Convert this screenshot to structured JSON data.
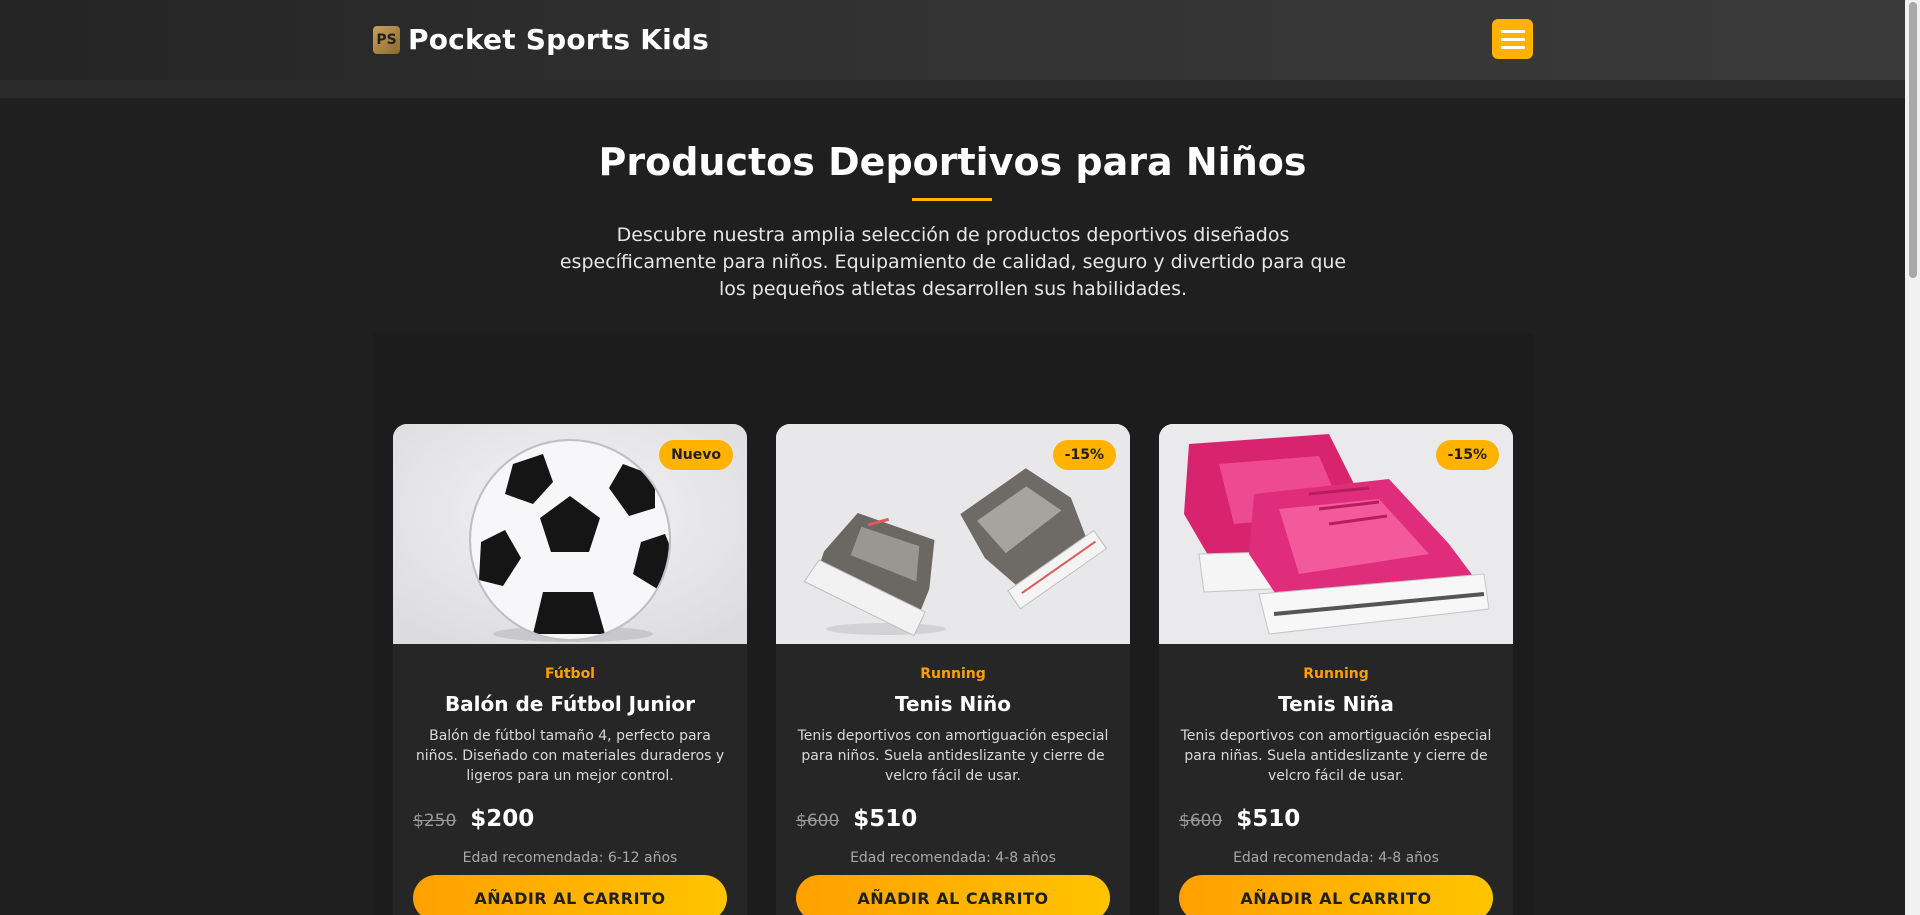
{
  "brand": {
    "logo_initials": "PS",
    "name": "Pocket Sports Kids"
  },
  "hero": {
    "title": "Productos Deportivos para Niños",
    "description": "Descubre nuestra amplia selección de productos deportivos diseñados específicamente para niños. Equipamiento de calidad, seguro y divertido para que los pequeños atletas desarrollen sus habilidades."
  },
  "colors": {
    "accent": "#ffb300",
    "background": "#1f1f1f",
    "card": "#262626"
  },
  "products": [
    {
      "badge": "Nuevo",
      "category": "Fútbol",
      "name": "Balón de Fútbol Junior",
      "description": "Balón de fútbol tamaño 4, perfecto para niños. Diseñado con materiales duraderos y ligeros para un mejor control.",
      "old_price": "$250",
      "price": "$200",
      "age": "Edad recomendada: 6-12 años",
      "button": "AÑADIR AL CARRITO",
      "image_icon": "soccer-ball"
    },
    {
      "badge": "-15%",
      "category": "Running",
      "name": "Tenis Niño",
      "description": "Tenis deportivos con amortiguación especial para niños. Suela antideslizante y cierre de velcro fácil de usar.",
      "old_price": "$600",
      "price": "$510",
      "age": "Edad recomendada: 4-8 años",
      "button": "AÑADIR AL CARRITO",
      "image_icon": "grey-sneakers"
    },
    {
      "badge": "-15%",
      "category": "Running",
      "name": "Tenis Niña",
      "description": "Tenis deportivos con amortiguación especial para niñas. Suela antideslizante y cierre de velcro fácil de usar.",
      "old_price": "$600",
      "price": "$510",
      "age": "Edad recomendada: 4-8 años",
      "button": "AÑADIR AL CARRITO",
      "image_icon": "pink-sneakers"
    }
  ]
}
